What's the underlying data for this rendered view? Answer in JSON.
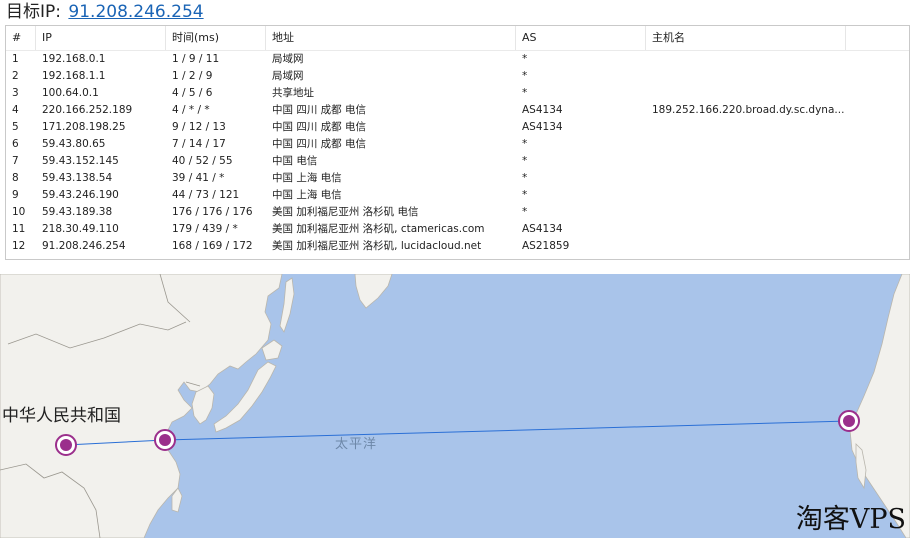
{
  "header": {
    "label": "目标IP:",
    "ip": "91.208.246.254"
  },
  "table": {
    "columns": [
      "#",
      "IP",
      "时间(ms)",
      "地址",
      "AS",
      "主机名"
    ],
    "rows": [
      {
        "n": "1",
        "ip": "192.168.0.1",
        "time": "1 / 9 / 11",
        "addr": "局域网",
        "as": "*",
        "host": ""
      },
      {
        "n": "2",
        "ip": "192.168.1.1",
        "time": "1 / 2 / 9",
        "addr": "局域网",
        "as": "*",
        "host": ""
      },
      {
        "n": "3",
        "ip": "100.64.0.1",
        "time": "4 / 5 / 6",
        "addr": "共享地址",
        "as": "*",
        "host": ""
      },
      {
        "n": "4",
        "ip": "220.166.252.189",
        "time": "4 / * / *",
        "addr": "中国 四川 成都 电信",
        "as": "AS4134",
        "host": "189.252.166.220.broad.dy.sc.dyna..."
      },
      {
        "n": "5",
        "ip": "171.208.198.25",
        "time": "9 / 12 / 13",
        "addr": "中国 四川 成都 电信",
        "as": "AS4134",
        "host": ""
      },
      {
        "n": "6",
        "ip": "59.43.80.65",
        "time": "7 / 14 / 17",
        "addr": "中国 四川 成都 电信",
        "as": "*",
        "host": ""
      },
      {
        "n": "7",
        "ip": "59.43.152.145",
        "time": "40 / 52 / 55",
        "addr": "中国 电信",
        "as": "*",
        "host": ""
      },
      {
        "n": "8",
        "ip": "59.43.138.54",
        "time": "39 / 41 / *",
        "addr": "中国 上海 电信",
        "as": "*",
        "host": ""
      },
      {
        "n": "9",
        "ip": "59.43.246.190",
        "time": "44 / 73 / 121",
        "addr": "中国 上海 电信",
        "as": "*",
        "host": ""
      },
      {
        "n": "10",
        "ip": "59.43.189.38",
        "time": "176 / 176 / 176",
        "addr": "美国 加利福尼亚州 洛杉矶 电信",
        "as": "*",
        "host": ""
      },
      {
        "n": "11",
        "ip": "218.30.49.110",
        "time": "179 / 439 / *",
        "addr": "美国 加利福尼亚州 洛杉矶, ctamericas.com",
        "as": "AS4134",
        "host": ""
      },
      {
        "n": "12",
        "ip": "91.208.246.254",
        "time": "168 / 169 / 172",
        "addr": "美国 加利福尼亚州 洛杉矶, lucidacloud.net",
        "as": "AS21859",
        "host": ""
      }
    ]
  },
  "map": {
    "country_label": "中华人民共和国",
    "ocean_label": "太平洋",
    "ocean_color": "#a9c4ea",
    "land_color": "#f2f1ed",
    "route_color": "#2a6fd6",
    "marker_color": "#9b2f8c"
  },
  "watermark": "淘客VPS"
}
